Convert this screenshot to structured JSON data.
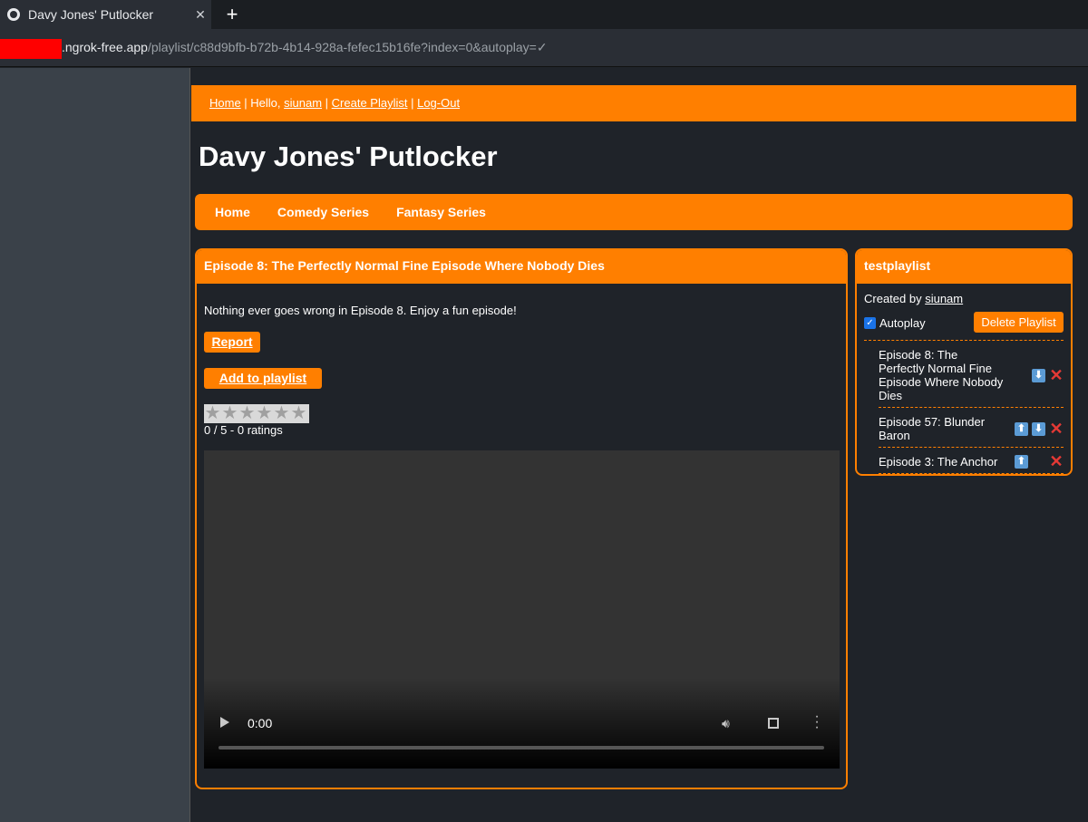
{
  "browser": {
    "tab_title": "Davy Jones' Putlocker",
    "tab_close": "✕",
    "new_tab": "+",
    "url_host": ".ngrok-free.app",
    "url_path": "/playlist/c88d9bfb-b72b-4b14-928a-fefec15b16fe?index=0&autoplay=✓"
  },
  "topbar": {
    "home": "Home",
    "sep1": " | Hello, ",
    "user": "siunam",
    "sep2": " | ",
    "create": "Create Playlist",
    "sep3": " | ",
    "logout": "Log-Out"
  },
  "site_title": "Davy Jones' Putlocker",
  "nav": [
    "Home",
    "Comedy Series",
    "Fantasy Series"
  ],
  "episode": {
    "title": "Episode 8: The Perfectly Normal Fine Episode Where Nobody Dies",
    "description": "Nothing ever goes wrong in Episode 8. Enjoy a fun episode!",
    "report_label": "Report",
    "add_label": "Add to playlist",
    "rating_text": "0 / 5 - 0 ratings",
    "rating_value": 0,
    "video_time": "0:00"
  },
  "playlist": {
    "name": "testplaylist",
    "created_by_prefix": "Created by ",
    "created_by": "siunam",
    "autoplay_label": "Autoplay",
    "autoplay_checked": true,
    "delete_label": "Delete Playlist",
    "items": [
      {
        "title": "Episode 8: The Perfectly Normal Fine Episode Where Nobody Dies",
        "up": false,
        "down": true
      },
      {
        "title": "Episode 57: Blunder Baron",
        "up": true,
        "down": true
      },
      {
        "title": "Episode 3: The Anchor",
        "up": true,
        "down": false
      }
    ]
  },
  "colors": {
    "accent": "#ff7f00",
    "background": "#1f2329"
  }
}
